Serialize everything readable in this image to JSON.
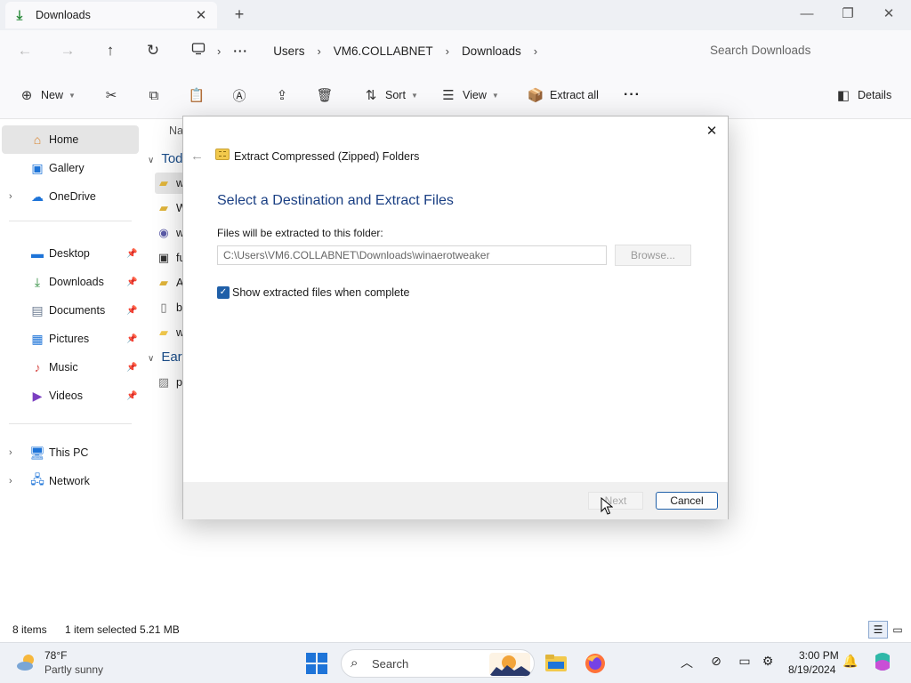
{
  "window": {
    "tab_title": "Downloads",
    "tab_close": "✕",
    "new_tab": "+",
    "minimize": "—",
    "maximize": "❐",
    "close": "✕"
  },
  "address": {
    "crumbs": [
      "Users",
      "VM6.COLLABNET",
      "Downloads"
    ],
    "search_placeholder": "Search Downloads"
  },
  "commands": {
    "new_label": "New",
    "sort_label": "Sort",
    "view_label": "View",
    "extract_all_label": "Extract all",
    "details_label": "Details"
  },
  "sidebar": {
    "items": [
      {
        "label": "Home",
        "icon": "home-icon"
      },
      {
        "label": "Gallery",
        "icon": "gallery-icon"
      },
      {
        "label": "OneDrive",
        "icon": "cloud-icon"
      },
      {
        "label": "Desktop",
        "icon": "desktop-icon"
      },
      {
        "label": "Downloads",
        "icon": "download-icon"
      },
      {
        "label": "Documents",
        "icon": "document-icon"
      },
      {
        "label": "Pictures",
        "icon": "pictures-icon"
      },
      {
        "label": "Music",
        "icon": "music-icon"
      },
      {
        "label": "Videos",
        "icon": "videos-icon"
      },
      {
        "label": "This PC",
        "icon": "computer-icon"
      },
      {
        "label": "Network",
        "icon": "network-icon"
      }
    ]
  },
  "filelist": {
    "column_name": "Na",
    "group_today": "Tod",
    "group_earlier": "Earl",
    "rows": [
      "w",
      "W",
      "w",
      "fu",
      "A",
      "b",
      "w"
    ],
    "earlier_rows": [
      "p"
    ]
  },
  "status": {
    "item_count": "8 items",
    "selection": "1 item selected  5.21 MB"
  },
  "dialog": {
    "title": "Extract Compressed (Zipped) Folders",
    "heading": "Select a Destination and Extract Files",
    "folder_label": "Files will be extracted to this folder:",
    "folder_path": "C:\\Users\\VM6.COLLABNET\\Downloads\\winaerotweaker",
    "browse_label": "Browse...",
    "show_files_label": "Show extracted files when complete",
    "show_files_checked": true,
    "next_label": "Next",
    "cancel_label": "Cancel"
  },
  "taskbar": {
    "weather_temp": "78°F",
    "weather_desc": "Partly sunny",
    "search_label": "Search",
    "time": "3:00 PM",
    "date": "8/19/2024"
  },
  "colors": {
    "accent": "#1f5fa8",
    "heading": "#1a3f83",
    "folder": "#f2c94c"
  }
}
